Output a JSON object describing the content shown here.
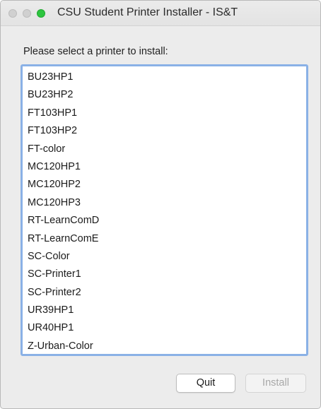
{
  "window": {
    "title": "CSU Student Printer Installer - IS&T"
  },
  "prompt": "Please select a printer to install:",
  "printers": [
    "BU23HP1",
    "BU23HP2",
    "FT103HP1",
    "FT103HP2",
    "FT-color",
    "MC120HP1",
    "MC120HP2",
    "MC120HP3",
    "RT-LearnComD",
    "RT-LearnComE",
    "SC-Color",
    "SC-Printer1",
    "SC-Printer2",
    "UR39HP1",
    "UR40HP1",
    "Z-Urban-Color"
  ],
  "buttons": {
    "quit": "Quit",
    "install": "Install",
    "install_enabled": false
  }
}
